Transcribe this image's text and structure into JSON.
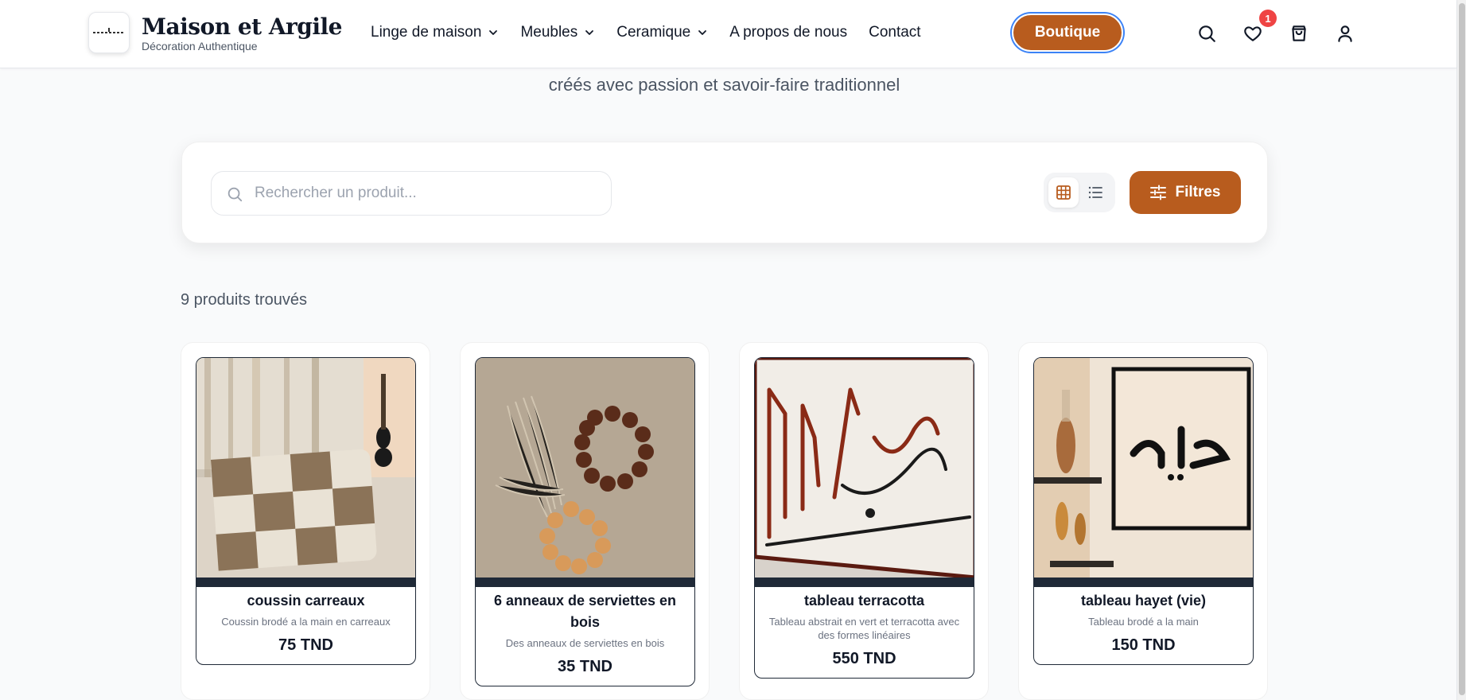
{
  "header": {
    "brand_name": "Maison et Argile",
    "brand_tagline": "Décoration Authentique",
    "nav": [
      {
        "label": "Linge de maison",
        "dropdown": true
      },
      {
        "label": "Meubles",
        "dropdown": true
      },
      {
        "label": "Ceramique",
        "dropdown": true
      },
      {
        "label": "A propos de nous",
        "dropdown": false
      },
      {
        "label": "Contact",
        "dropdown": false
      }
    ],
    "shop_button": "Boutique",
    "wishlist_count": "1",
    "icons": [
      "search-icon",
      "heart-icon",
      "shopping-bag-icon",
      "user-icon"
    ]
  },
  "hero": {
    "subtitle": "créés avec passion et savoir-faire traditionnel"
  },
  "search": {
    "placeholder": "Rechercher un produit...",
    "value": "",
    "filters_label": "Filtres",
    "active_view": "grid"
  },
  "results": {
    "count_text": "9 produits trouvés",
    "products": [
      {
        "title": "coussin carreaux",
        "description": "Coussin brodé a la main en carreaux",
        "price": "75 TND"
      },
      {
        "title": "6 anneaux de serviettes en bois",
        "description": "Des anneaux de serviettes en bois",
        "price": "35 TND"
      },
      {
        "title": "tableau terracotta",
        "description": "Tableau abstrait en vert et terracotta avec des formes linéaires",
        "price": "550 TND"
      },
      {
        "title": "tableau hayet (vie)",
        "description": "Tableau brodé a la main",
        "price": "150 TND"
      }
    ]
  },
  "colors": {
    "accent": "#b85c1e",
    "dark": "#1f2937",
    "badge": "#ef4444",
    "text_muted": "#4b5563"
  }
}
